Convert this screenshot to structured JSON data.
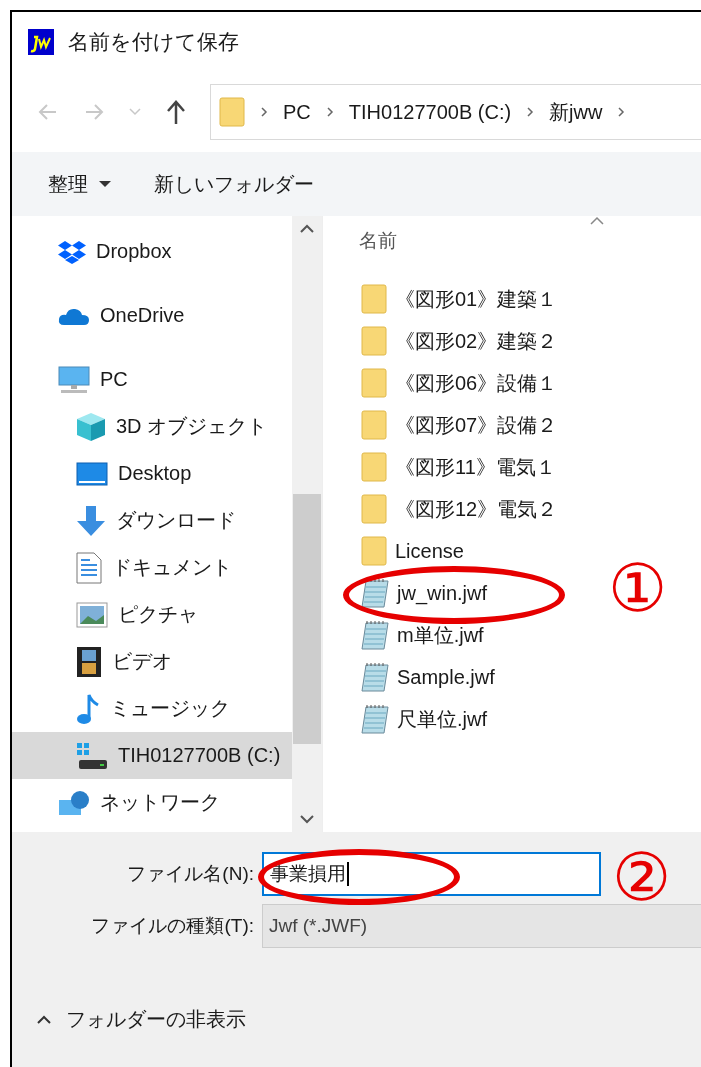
{
  "window": {
    "title": "名前を付けて保存"
  },
  "address_bar": {
    "path": [
      "PC",
      "TIH0127700B (C:)",
      "新jww"
    ]
  },
  "toolbar": {
    "buttons": [
      "整理",
      "新しいフォルダー"
    ]
  },
  "nav_pane": {
    "items": [
      {
        "label": "Dropbox",
        "kind": "dropbox",
        "selected": false
      },
      {
        "label": "OneDrive",
        "kind": "cloud",
        "selected": false
      },
      {
        "label": "PC",
        "kind": "pc",
        "selected": false,
        "children": [
          {
            "label": "3D オブジェクト",
            "kind": "cube",
            "selected": false
          },
          {
            "label": "Desktop",
            "kind": "desktop",
            "selected": false
          },
          {
            "label": "ダウンロード",
            "kind": "download",
            "selected": false
          },
          {
            "label": "ドキュメント",
            "kind": "document",
            "selected": false
          },
          {
            "label": "ピクチャ",
            "kind": "picture",
            "selected": false
          },
          {
            "label": "ビデオ",
            "kind": "video",
            "selected": false
          },
          {
            "label": "ミュージック",
            "kind": "music",
            "selected": false
          },
          {
            "label": "TIH0127700B (C:)",
            "kind": "drive",
            "selected": true
          }
        ]
      },
      {
        "label": "ネットワーク",
        "kind": "network",
        "selected": false
      }
    ]
  },
  "file_list": {
    "column": "名前",
    "items": [
      {
        "name": "《図形01》建築１",
        "kind": "folder"
      },
      {
        "name": "《図形02》建築２",
        "kind": "folder"
      },
      {
        "name": "《図形06》設備１",
        "kind": "folder"
      },
      {
        "name": "《図形07》設備２",
        "kind": "folder"
      },
      {
        "name": "《図形11》電気１",
        "kind": "folder"
      },
      {
        "name": "《図形12》電気２",
        "kind": "folder"
      },
      {
        "name": "License",
        "kind": "folder"
      },
      {
        "name": "jw_win.jwf",
        "kind": "file"
      },
      {
        "name": "m単位.jwf",
        "kind": "file"
      },
      {
        "name": "Sample.jwf",
        "kind": "file"
      },
      {
        "name": "尺単位.jwf",
        "kind": "file"
      }
    ]
  },
  "form": {
    "file_name": {
      "label": "ファイル名(N):",
      "value": "事業損用"
    },
    "file_type": {
      "label": "ファイルの種類(T):",
      "value": "Jwf (*.JWF)"
    }
  },
  "hide_folders": "フォルダーの非表示",
  "annotations": [
    {
      "label": "①"
    },
    {
      "label": "②"
    }
  ]
}
